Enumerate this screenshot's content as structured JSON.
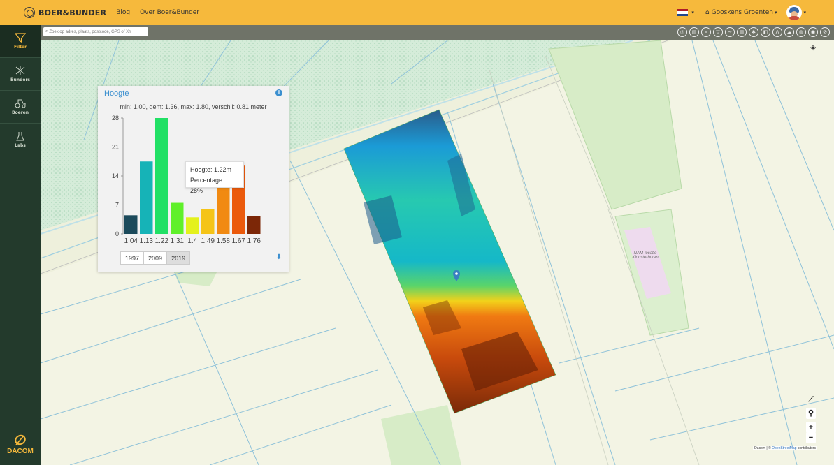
{
  "header": {
    "brand": "BOER&BUNDER",
    "nav": [
      "Blog",
      "Over Boer&Bunder"
    ],
    "company": "Gooskens Groenten",
    "flag_colors": [
      "#ae1c28",
      "#ffffff",
      "#21468b"
    ],
    "accent": "#f6b93c"
  },
  "sidebar": {
    "items": [
      {
        "label": "Filter",
        "icon": "filter-icon"
      },
      {
        "label": "Bunders",
        "icon": "bunders-icon"
      },
      {
        "label": "Boeren",
        "icon": "tractor-icon"
      },
      {
        "label": "Labs",
        "icon": "flask-icon"
      }
    ],
    "footer_brand": "DACOM"
  },
  "map": {
    "search_placeholder": "Zoek op adres, plaats, postcode, GPS of XY",
    "label": "NAM-locatie Kloosterburen",
    "zoom_in": "+",
    "zoom_out": "−",
    "attribution_prefix": "Dacom | © ",
    "attribution_link": "OpenStreetMap",
    "attribution_suffix": " contributors"
  },
  "panel": {
    "title": "Hoogte",
    "stats": "min: 1.00, gem: 1.36, max: 1.80, verschil: 0.81 meter",
    "years": [
      "1997",
      "2009",
      "2019"
    ],
    "active_year": "2019",
    "tooltip": {
      "line1": "Hoogte: 1.22m",
      "line2": "Percentage : 28%"
    }
  },
  "chart_data": {
    "type": "bar",
    "categories": [
      "1.04",
      "1.13",
      "1.22",
      "1.31",
      "1.4",
      "1.49",
      "1.58",
      "1.67",
      "1.76"
    ],
    "values": [
      4.5,
      17.5,
      28,
      7.5,
      4,
      6,
      12,
      16.5,
      4.3
    ],
    "colors": [
      "#1b4a5b",
      "#16b3b7",
      "#21e065",
      "#5ff02a",
      "#e4f11c",
      "#f5c417",
      "#f18a12",
      "#eb5a0c",
      "#7c2707"
    ],
    "yticks": [
      0,
      7,
      14,
      21,
      28
    ],
    "ylim": [
      0,
      28
    ]
  }
}
